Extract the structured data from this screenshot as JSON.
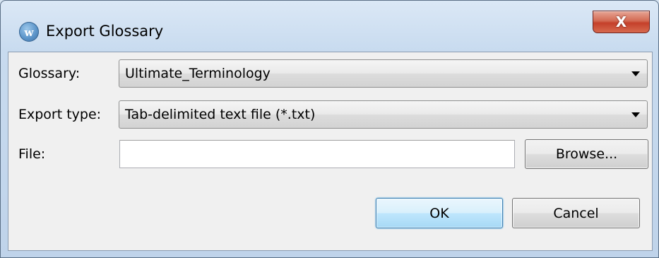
{
  "window": {
    "title": "Export Glossary",
    "app_icon_glyph": "w",
    "close_glyph": "X",
    "close_color": "#c4402a"
  },
  "form": {
    "glossary": {
      "label": "Glossary:",
      "selected": "Ultimate_Terminology"
    },
    "export_type": {
      "label": "Export type:",
      "selected": "Tab-delimited text file (*.txt)"
    },
    "file": {
      "label": "File:",
      "value": "",
      "browse_label": "Browse..."
    }
  },
  "buttons": {
    "ok_label": "OK",
    "cancel_label": "Cancel"
  },
  "icons": {
    "app": "app-logo-icon",
    "close": "close-icon",
    "dropdown": "chevron-down-icon"
  }
}
